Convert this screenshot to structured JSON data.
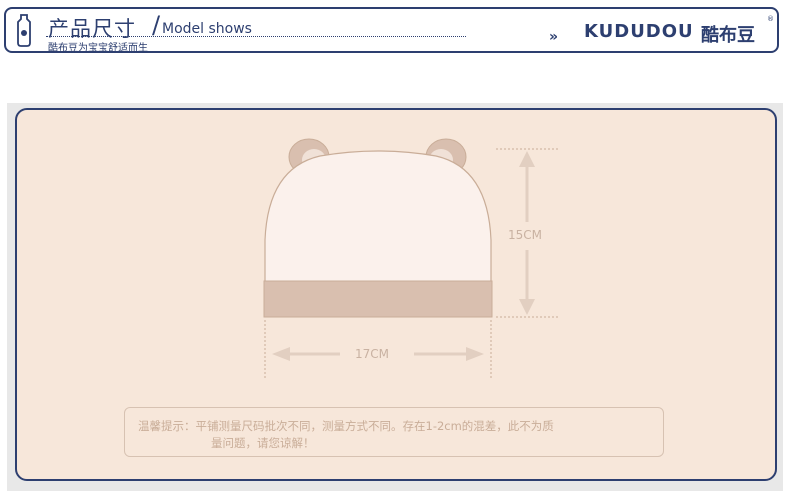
{
  "header": {
    "title_cn": "产品尺寸",
    "slash": "/",
    "title_en": "Model shows",
    "subtitle": "酷布豆为宝宝舒适而生",
    "chevrons": "»",
    "brand_en": "KUDUDOU",
    "brand_cn": "酷布豆",
    "reg_mark": "®"
  },
  "product": {
    "height_label": "15CM",
    "width_label": "17CM"
  },
  "note": {
    "line1": "温馨提示：平铺测量尺码批次不同，测量方式不同。存在1-2cm的混差，此不为质",
    "line2": "量问题，请您谅解！"
  },
  "colors": {
    "navy": "#2d3f70",
    "panel": "#f7e7da",
    "hat_brim": "#d9bfaf",
    "hat_body": "#fbf1ec",
    "ear": "#d9bfaf",
    "dim": "#e2cfc1"
  }
}
